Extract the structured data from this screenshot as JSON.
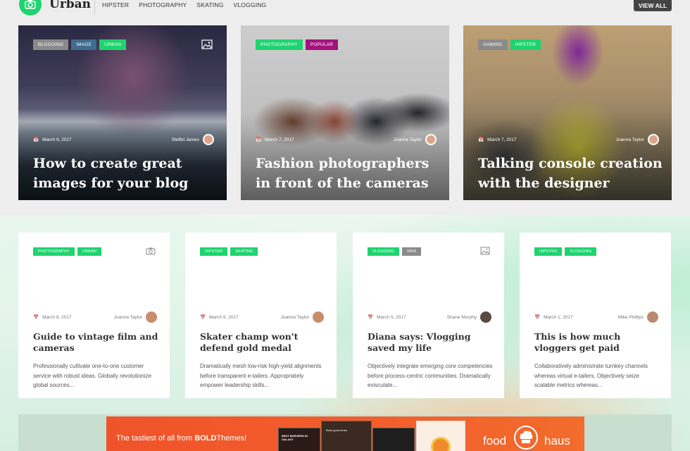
{
  "header": {
    "logo_text": "Urban",
    "nav": [
      "HIPSTER",
      "PHOTOGRAPHY",
      "SKATING",
      "VLOGGING"
    ],
    "view_all": "VIEW ALL"
  },
  "colors": {
    "accent": "#1fd36f",
    "tag_grey": "#8a8a8a",
    "tag_blue": "#3f6b8e",
    "tag_magenta": "#a3137e"
  },
  "hero_posts": [
    {
      "tags": [
        {
          "label": "BLOGGING",
          "color": "#8a8a8a"
        },
        {
          "label": "IMAGE",
          "color": "#3f6b8e"
        },
        {
          "label": "URBAN",
          "color": "#1fd36f"
        }
      ],
      "date": "March 9, 2017",
      "author": "Steffel James",
      "title": "How to create great images for your blog",
      "icon": "image-icon"
    },
    {
      "tags": [
        {
          "label": "PHOTOGRAPHY",
          "color": "#1fd36f"
        },
        {
          "label": "POPULAR",
          "color": "#a3137e"
        }
      ],
      "date": "March 7, 2017",
      "author": "Joanna Taylor",
      "title": "Fashion photographers in front of the cameras"
    },
    {
      "tags": [
        {
          "label": "GAMING",
          "color": "#8a8a8a"
        },
        {
          "label": "HIPSTER",
          "color": "#1fd36f"
        }
      ],
      "date": "March 7, 2017",
      "author": "Joanna Taylor",
      "title": "Talking console creation with the designer"
    }
  ],
  "cards": [
    {
      "tags": [
        {
          "label": "PHOTOGRAPHY",
          "color": "#1fd36f"
        },
        {
          "label": "URBAN",
          "color": "#1fd36f"
        }
      ],
      "icon": "camera-icon",
      "date": "March 6, 2017",
      "author": "Joanna Taylor",
      "title": "Guide to vintage film and cameras",
      "excerpt": "Professionally cultivate one-to-one customer service with robust ideas. Globally revolutionize global sources..."
    },
    {
      "tags": [
        {
          "label": "HIPSTER",
          "color": "#1fd36f"
        },
        {
          "label": "SKATING",
          "color": "#1fd36f"
        }
      ],
      "date": "March 6, 2017",
      "author": "Joanna Taylor",
      "title": "Skater champ won't defend gold medal",
      "excerpt": "Dramatically mesh low-risk high-yield alignments before transparent e-tailers. Appropriately empower leadership skills..."
    },
    {
      "tags": [
        {
          "label": "VLOGGING",
          "color": "#1fd36f"
        },
        {
          "label": "WEB",
          "color": "#8a8a8a"
        }
      ],
      "icon": "image-icon",
      "date": "March 5, 2017",
      "author": "Shane Murphy",
      "title": "Diana says: Vlogging saved my life",
      "excerpt": "Objectively integrate emerging core competencies before process-centric communities. Dramatically evisculate..."
    },
    {
      "tags": [
        {
          "label": "HIPSTER",
          "color": "#1fd36f"
        },
        {
          "label": "VLOGGING",
          "color": "#1fd36f"
        }
      ],
      "date": "March 1, 2017",
      "author": "Mike Phillips",
      "title": "This is how much vloggers get paid",
      "excerpt": "Collaboratively administrate turnkey channels whereas virtual e-tailers. Objectively seize scalable metrics whereas..."
    }
  ],
  "banner": {
    "text_prefix": "The tastiest of all from ",
    "text_brand": "BOLD",
    "text_suffix": "Themes!",
    "shot1_label": "BEST BURGERS IN GALAXY",
    "shot2_label": "Book good times",
    "brand_left": "food",
    "brand_right": "haus"
  }
}
